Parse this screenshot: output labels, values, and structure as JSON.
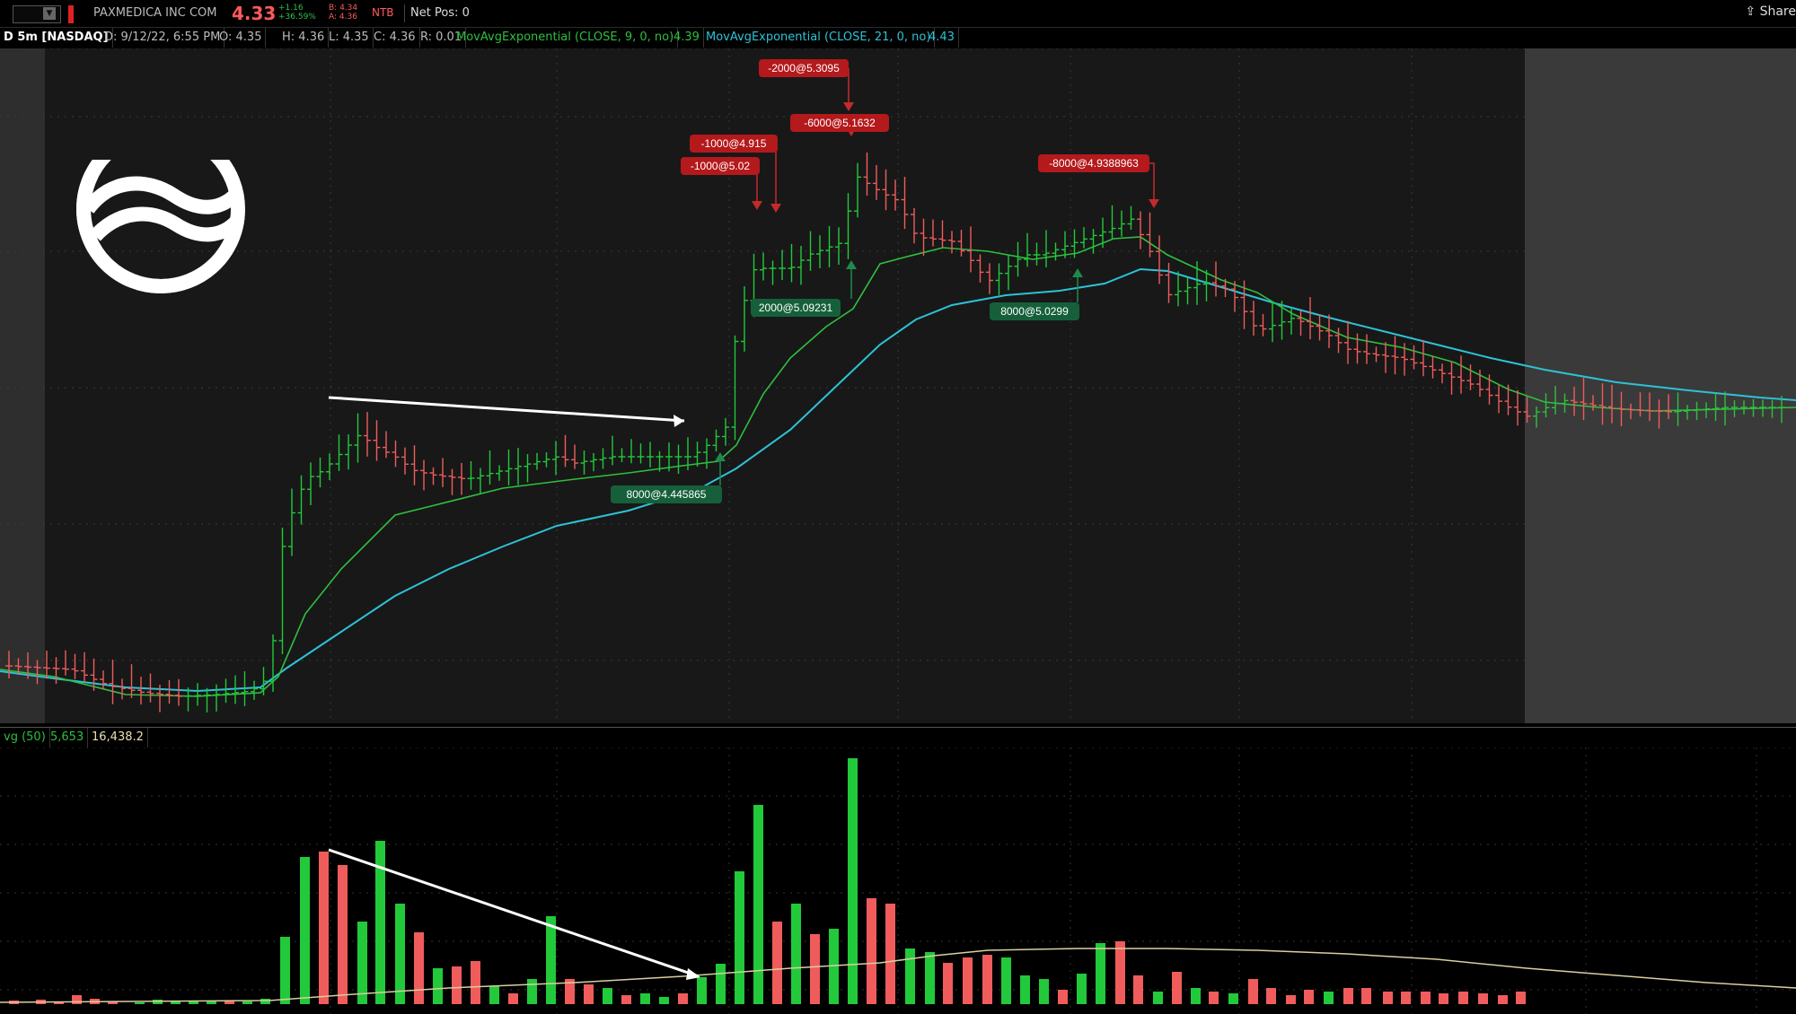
{
  "topbar": {
    "symbol_name": "PAXMEDICA INC COM",
    "last_price": "4.33",
    "change_abs": "+1.16",
    "change_pct": "+36.59%",
    "bid": "B: 4.34",
    "ask": "A: 4.36",
    "ntb": "NTB",
    "net_pos": "Net Pos: 0",
    "share_label": "Share",
    "dropdown_glyph": "▼"
  },
  "info": {
    "symbol": "D 5m [NASDAQ]",
    "date": "D: 9/12/22, 6:55 PM",
    "open": "O: 4.35",
    "high": "H: 4.36",
    "low": "L: 4.35",
    "close": "C: 4.36",
    "range": "R: 0.01",
    "ema9_label": "MovAvgExponential (CLOSE, 9, 0, no)",
    "ema9_value": "4.39",
    "ema21_label": "MovAvgExponential (CLOSE, 21, 0, no)",
    "ema21_value": "4.43"
  },
  "volume_info": {
    "label": "vg (50)",
    "value1": "5,653",
    "value2": "16,438.2"
  },
  "colors": {
    "up": "#22c93a",
    "down": "#f05c5c",
    "ema9": "#2fbf3f",
    "ema21": "#2ec2d6",
    "sell_tag": "#b4191c",
    "buy_tag": "#15603a",
    "vol_avg": "#d8cfa0"
  },
  "trades": [
    {
      "label": "-2000@5.3095",
      "type": "sell"
    },
    {
      "label": "-6000@5.1632",
      "type": "sell"
    },
    {
      "label": "-1000@4.915",
      "type": "sell"
    },
    {
      "label": "-1000@5.02",
      "type": "sell"
    },
    {
      "label": "-8000@4.9388963",
      "type": "sell"
    },
    {
      "label": "2000@5.09231",
      "type": "buy"
    },
    {
      "label": "8000@5.0299",
      "type": "buy"
    },
    {
      "label": "8000@4.445865",
      "type": "buy"
    }
  ]
}
